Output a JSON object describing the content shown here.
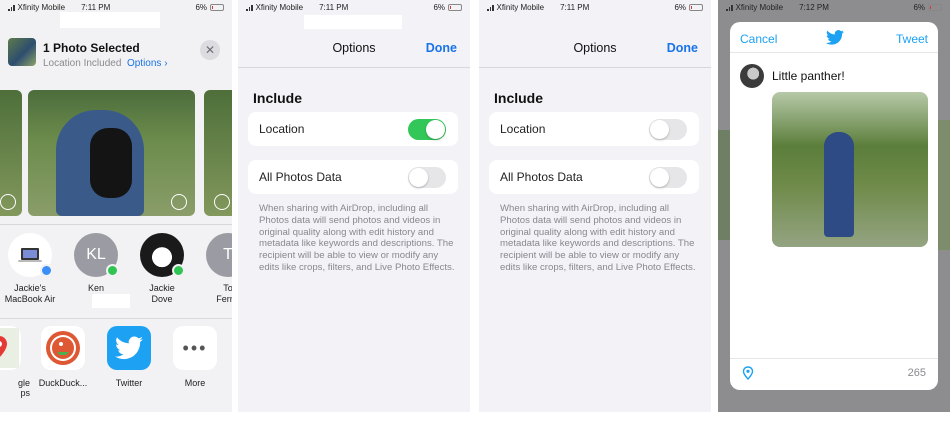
{
  "status": {
    "carrier": "Xfinity Mobile",
    "time_panels": [
      "7:11 PM",
      "7:11 PM",
      "7:11 PM",
      "7:12 PM"
    ],
    "battery": "6%"
  },
  "share": {
    "title": "1 Photo Selected",
    "subtitle": "Location Included",
    "options_link": "Options",
    "contacts": [
      {
        "name": "Jackie's\nMacBook Air",
        "initials": ""
      },
      {
        "name": "Ken",
        "initials": "KL"
      },
      {
        "name": "Jackie\nDove",
        "initials": ""
      },
      {
        "name": "To\nFerna",
        "initials": "T"
      }
    ],
    "apps": [
      {
        "label": "gle\nps",
        "icon": "maps-icon"
      },
      {
        "label": "DuckDuck...",
        "icon": "duckduckgo-icon"
      },
      {
        "label": "Twitter",
        "icon": "twitter-icon"
      },
      {
        "label": "More",
        "icon": "more-icon"
      }
    ]
  },
  "options_a": {
    "title": "Options",
    "done": "Done",
    "section": "Include",
    "location_label": "Location",
    "location_on": true,
    "all_photos_label": "All Photos Data",
    "all_photos_on": false,
    "description": "When sharing with AirDrop, including all Photos data will send photos and videos in original quality along with edit history and metadata like keywords and descriptions. The recipient will be able to view or modify any edits like crops, filters, and Live Photo Effects."
  },
  "options_b": {
    "title": "Options",
    "done": "Done",
    "section": "Include",
    "location_label": "Location",
    "location_on": false,
    "all_photos_label": "All Photos Data",
    "all_photos_on": false,
    "description": "When sharing with AirDrop, including all Photos data will send photos and videos in original quality along with edit history and metadata like keywords and descriptions. The recipient will be able to view or modify any edits like crops, filters, and Live Photo Effects."
  },
  "tweet": {
    "cancel": "Cancel",
    "tweet_button": "Tweet",
    "text": "Little panther!",
    "char_count": "265"
  },
  "colors": {
    "ios_blue": "#1a73e8",
    "twitter_blue": "#1da1f2",
    "toggle_green": "#33c759"
  }
}
